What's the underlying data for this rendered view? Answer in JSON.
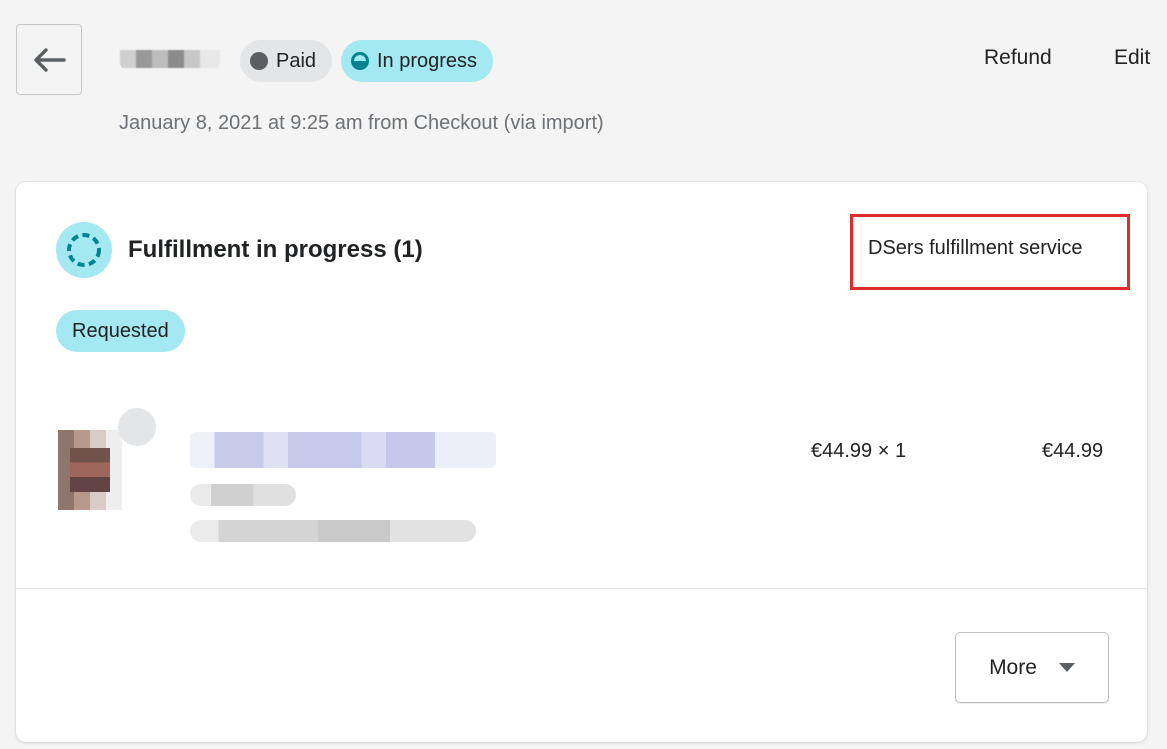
{
  "header": {
    "back_icon": "arrow-left-icon",
    "paid_badge": "Paid",
    "status_badge": "In progress",
    "refund_label": "Refund",
    "edit_label": "Edit",
    "subtitle": "January 8, 2021 at 9:25 am from Checkout (via import)"
  },
  "fulfillment": {
    "status_icon": "progress-circle-icon",
    "title": "Fulfillment in progress (1)",
    "service": "DSers fulfillment service",
    "request_badge": "Requested",
    "line_item": {
      "unit_price": "€44.99 × 1",
      "total": "€44.99"
    },
    "more_label": "More",
    "more_icon": "caret-down-icon"
  },
  "colors": {
    "accent_teal": "#a4e8f2",
    "highlight_red": "#e02b2b"
  }
}
